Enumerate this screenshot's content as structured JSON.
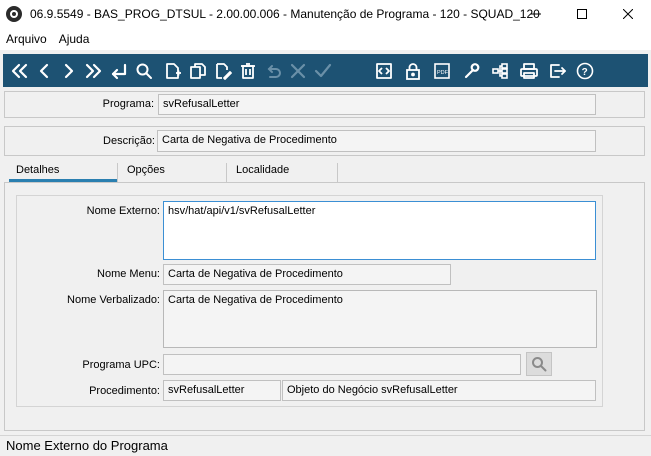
{
  "window": {
    "title": "06.9.5549 - BAS_PROG_DTSUL - 2.00.00.006 - Manutenção de Programa - 120 - SQUAD_120",
    "minimize_icon": "minimize-icon",
    "maximize_icon": "maximize-icon",
    "close_icon": "close-icon"
  },
  "menu": {
    "items": [
      "Arquivo",
      "Ajuda"
    ]
  },
  "toolbar": {
    "buttons": [
      {
        "icon": "first-record-icon"
      },
      {
        "icon": "previous-record-icon"
      },
      {
        "icon": "next-record-icon"
      },
      {
        "icon": "last-record-icon"
      },
      {
        "icon": "goto-icon"
      },
      {
        "icon": "search-icon"
      },
      {
        "icon": "add-icon"
      },
      {
        "icon": "copy-icon"
      },
      {
        "icon": "edit-icon"
      },
      {
        "icon": "delete-icon"
      },
      {
        "icon": "undo-icon",
        "disabled": true
      },
      {
        "icon": "cancel-icon",
        "disabled": true
      },
      {
        "icon": "confirm-icon",
        "disabled": true
      },
      {
        "icon": "code-icon"
      },
      {
        "icon": "lock-icon"
      },
      {
        "icon": "pdf-icon"
      },
      {
        "icon": "tools-icon"
      },
      {
        "icon": "hierarchy-icon"
      },
      {
        "icon": "print-icon"
      },
      {
        "icon": "exit-icon"
      },
      {
        "icon": "help-icon"
      }
    ]
  },
  "form": {
    "programa_label": "Programa:",
    "programa_value": "svRefusalLetter",
    "descricao_label": "Descrição:",
    "descricao_value": "Carta de Negativa de Procedimento"
  },
  "tabs": [
    "Detalhes",
    "Opções",
    "Localidade"
  ],
  "active_tab": "Detalhes",
  "detalhes": {
    "nome_externo_label": "Nome Externo:",
    "nome_externo_value": "hsv/hat/api/v1/svRefusalLetter",
    "nome_menu_label": "Nome Menu:",
    "nome_menu_value": "Carta de Negativa de Procedimento",
    "nome_verbalizado_label": "Nome Verbalizado:",
    "nome_verbalizado_value": "Carta de Negativa de Procedimento",
    "programa_upc_label": "Programa UPC:",
    "programa_upc_value": "",
    "procedimento_label": "Procedimento:",
    "procedimento_value": "svRefusalLetter",
    "procedimento_desc": "Objeto do Negócio svRefusalLetter"
  },
  "status": "Nome Externo do Programa",
  "colors": {
    "toolbar_bg": "#1d5273",
    "tab_accent": "#2a7fb0",
    "focus_border": "#3b8fd4"
  }
}
